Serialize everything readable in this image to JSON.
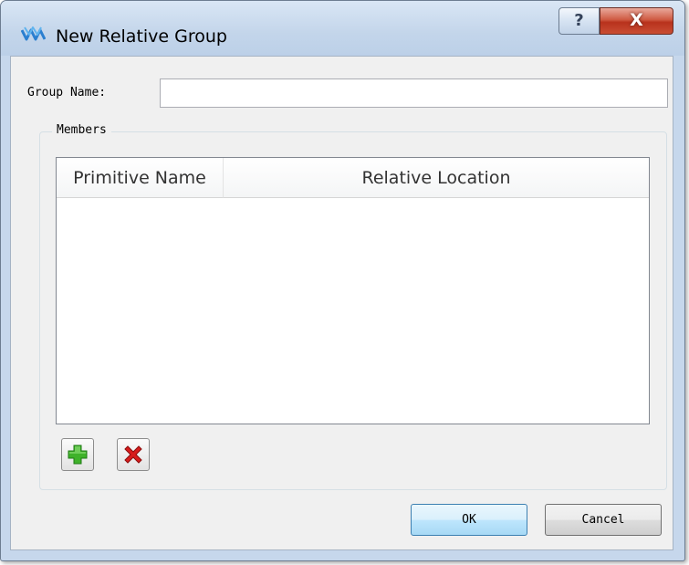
{
  "window": {
    "title": "New Relative Group",
    "help_label": "?",
    "close_label": "X"
  },
  "form": {
    "group_name_label": "Group Name:",
    "group_name_value": "",
    "group_name_placeholder": ""
  },
  "members": {
    "title": "Members",
    "columns": [
      "Primitive Name",
      "Relative Location"
    ],
    "rows": []
  },
  "toolbar": {
    "add_icon": "plus-icon",
    "remove_icon": "delete-x-icon"
  },
  "buttons": {
    "ok": "OK",
    "cancel": "Cancel"
  },
  "colors": {
    "add_green": "#3fb22a",
    "remove_red": "#d81c1c",
    "close_red": "#c7452f"
  }
}
